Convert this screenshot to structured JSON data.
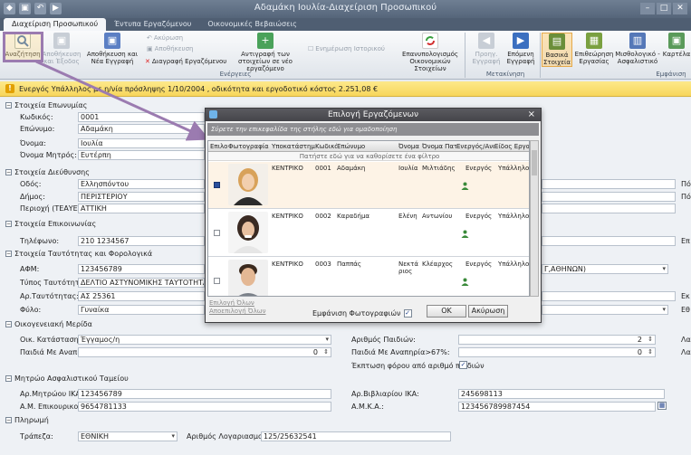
{
  "window": {
    "title": "Αδαμάκη Ιουλία-Διαχείριση Προσωπικού",
    "minimize": "–",
    "maximize": "□",
    "close": "✕"
  },
  "tabs": [
    {
      "label": "Διαχείριση Προσωπικού",
      "active": true
    },
    {
      "label": "Έντυπα Εργαζόμενου",
      "active": false
    },
    {
      "label": "Οικονομικές Βεβαιώσεις",
      "active": false
    }
  ],
  "ribbon": {
    "search": "Αναζήτηση",
    "save_exit": "Αποθήκευση και Έξοδος",
    "save_new": "Αποθήκευση και Νέα Εγγραφή",
    "cancel": "Ακύρωση",
    "save": "Αποθήκευση",
    "delete_employee": "Διαγραφή Εργαζόμενου",
    "copy_to_new": "Αντιγραφή των στοιχείων σε νέο εργαζόμενο",
    "update_history": "Ενημέρωση Ιστορικού",
    "recalc_financials": "Επανυπολογισμός Οικονομικών Στοιχείων",
    "group_actions": "Ενέργειες",
    "prev_record": "Προηγ. Εγγραφή",
    "next_record": "Επόμενη Εγγραφή",
    "group_navigation": "Μετακίνηση",
    "basic_info": "Βασικά Στοιχεία",
    "review_work": "Επιθεώρηση Εργασίας",
    "salary_insurance": "Μισθολογικό - Ασφαλιστικό",
    "card": "Καρτέλα",
    "group_display": "Εμφάνιση"
  },
  "status": {
    "text": "Ενεργός Υπάλληλος με η/νία πρόσληψης 1/10/2004 , οδικότητα και εργοδοτικό κόστος 2.251,08 €"
  },
  "form": {
    "sections": {
      "name": "Στοιχεία Επωνυμίας",
      "address": "Στοιχεία Διεύθυνσης",
      "contact": "Στοιχεία Επικοινωνίας",
      "identity": "Στοιχεία Ταυτότητας και Φορολογικά",
      "family": "Οικογενειακή Μερίδα",
      "insurance": "Μητρώο Ασφαλιστικού Ταμείου",
      "payment": "Πληρωμή"
    },
    "code_label": "Κωδικός:",
    "code": "0001",
    "surname_label": "Επώνυμο:",
    "surname": "Αδαμάκη",
    "firstname_label": "Όνομα:",
    "firstname": "Ιουλία",
    "mother_label": "Όνομα Μητρός:",
    "mother": "Ευτέρπη",
    "street_label": "Οδός:",
    "street": "Ελλησπόντου",
    "municipality_label": "Δήμος:",
    "municipality": "ΠΕΡΙΣΤΕΡΙΟΥ",
    "region_label": "Περιοχή (ΤΕΑΥΕΤ):",
    "region": "ΑΤΤΙΚΗ",
    "phone_label": "Τηλέφωνο:",
    "phone": "210 1234567",
    "afm_label": "ΑΦΜ:",
    "afm": "123456789",
    "idtype_label": "Τύπος Ταυτότητας:",
    "idtype": "ΔΕΛΤΙΟ ΑΣΤΥΝΟΜΙΚΗΣ ΤΑΥΤΟΤΗΤΑΣ",
    "idnum_label": "Αρ.Ταυτότητας:",
    "idnum": "ΑΣ 25361",
    "gender_label": "Φύλο:",
    "gender": "Γυναίκα",
    "doy_partial": "Γ,ΑΘΗΝΩΝ)",
    "marital_label": "Οικ. Κατάσταση:",
    "marital": "Έγγαμος/η",
    "children_label": "Αριθμός Παιδιών:",
    "children": "2",
    "disabled_children_label": "Παιδιά Με Αναπηρία:",
    "disabled_children": "0",
    "disabled67_label": "Παιδιά Με Αναπηρία>67%:",
    "disabled67": "0",
    "tax_deduction_label": "Έκπτωση φόρου από αριθμό παιδιών",
    "ika_label": "Αρ.Μητρώου ΙΚΑ:",
    "ika": "123456789",
    "employer_am_label": "Α.Μ. Επικουρικού:",
    "employer_am": "9654781133",
    "booklet_label": "Αρ.Βιβλιαρίου ΙΚΑ:",
    "booklet": "245698113",
    "amka_label": "Α.Μ.Κ.Α.:",
    "amka": "123456789987454",
    "bank_label": "Τράπεζα:",
    "bank": "ΕΘΝΙΚΗ",
    "account_label": "Αριθμός Λογαριασμού:",
    "account": "125/25632541",
    "right_partial": {
      "p1": "Πό",
      "p2": "Πό",
      "ep": "Επ",
      "ek": "Εκ",
      "eth": "Εθ",
      "la1": "Λα",
      "la2": "Λα"
    }
  },
  "modal": {
    "title": "Επιλογή Εργαζόμενων",
    "close": "×",
    "group_hint": "Σύρετε την επικεφαλίδα της στήλης εδώ για ομαδοποίηση",
    "filter_hint": "Πατήστε εδώ για να καθορίσετε ένα φίλτρο",
    "columns": [
      "Επιλο",
      "Φωτογραφία",
      "Υποκατάστημα",
      "Κωδικό",
      "Επώνυμο",
      "Όνομα",
      "Όνομα Πατ",
      "Ενεργός/Ανε",
      "Είδος Εργαζ"
    ],
    "rows": [
      {
        "branch": "ΚΕΝΤΡΙΚΟ",
        "code": "0001",
        "surname": "Αδαμάκη",
        "name": "Ιουλία",
        "father": "Μιλτιάδης",
        "active": "Ενεργός",
        "type": "Υπάλληλος",
        "selected": true
      },
      {
        "branch": "ΚΕΝΤΡΙΚΟ",
        "code": "0002",
        "surname": "Καραδήμα",
        "name": "Ελένη",
        "father": "Αντωνίου",
        "active": "Ενεργός",
        "type": "Υπάλληλος",
        "selected": false
      },
      {
        "branch": "ΚΕΝΤΡΙΚΟ",
        "code": "0003",
        "surname": "Παππάς",
        "name": "Νεκτάριος",
        "father": "Κλέαρχος",
        "active": "Ενεργός",
        "type": "Υπάλληλος",
        "selected": false
      }
    ],
    "select_all": "Επιλογή Όλων",
    "deselect_all": "Αποεπιλογή Όλων",
    "show_photos": "Εμφάνιση Φωτογραφιών",
    "ok": "ΟΚ",
    "cancel": "Ακύρωση"
  }
}
